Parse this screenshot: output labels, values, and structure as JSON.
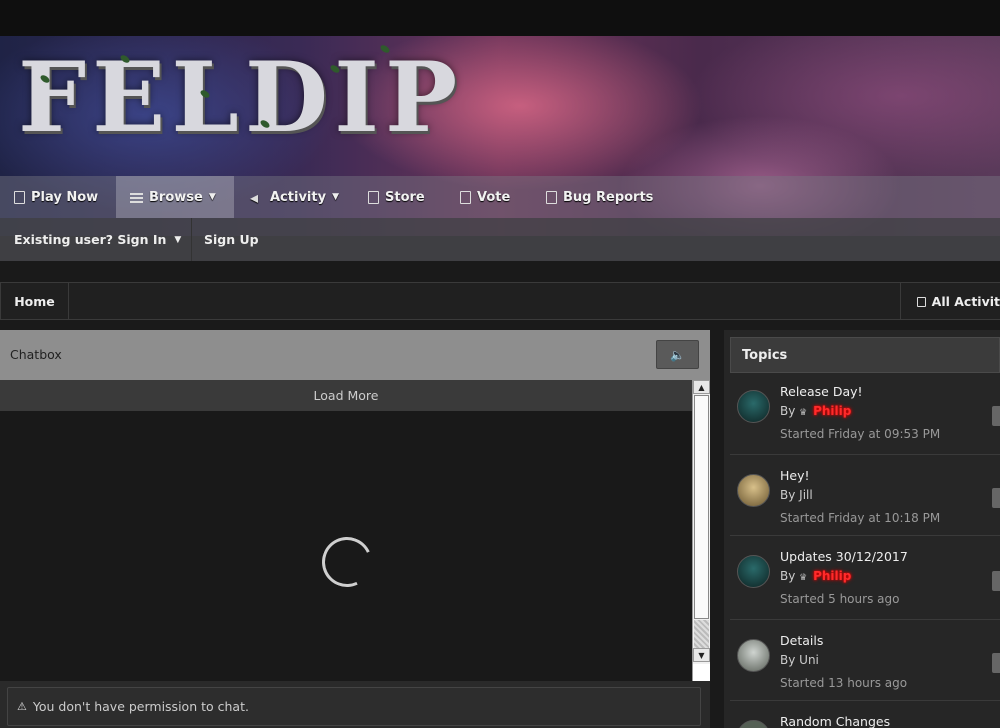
{
  "site": {
    "logo_text": "FELDIP"
  },
  "nav": {
    "items": [
      {
        "label": "Play Now",
        "icon": "file-icon"
      },
      {
        "label": "Browse",
        "icon": "list-icon",
        "active": true,
        "dropdown": true
      },
      {
        "label": "Activity",
        "icon": "megaphone-icon",
        "dropdown": true
      },
      {
        "label": "Store",
        "icon": "file-icon"
      },
      {
        "label": "Vote",
        "icon": "file-icon"
      },
      {
        "label": "Bug Reports",
        "icon": "file-icon"
      }
    ]
  },
  "userbar": {
    "signin_label": "Existing user? Sign In",
    "signup_label": "Sign Up"
  },
  "breadcrumb": {
    "home_label": "Home",
    "all_activity_label": "All Activit"
  },
  "chatbox": {
    "title": "Chatbox",
    "load_more_label": "Load More",
    "permission_message": "You don't have permission to chat."
  },
  "topics": {
    "title": "Topics",
    "items": [
      {
        "title": "Release Day!",
        "by": "By",
        "author": "Philip",
        "author_style": "highlight",
        "started": "Started Friday at 09:53 PM"
      },
      {
        "title": "Hey!",
        "by": "By",
        "author": "Jill",
        "author_style": "plain",
        "started": "Started Friday at 10:18 PM"
      },
      {
        "title": "Updates 30/12/2017",
        "by": "By",
        "author": "Philip",
        "author_style": "highlight",
        "started": "Started 5 hours ago"
      },
      {
        "title": "Details",
        "by": "By",
        "author": "Uni",
        "author_style": "plain",
        "started": "Started 13 hours ago"
      },
      {
        "title": "Random Changes",
        "by": "",
        "author": "",
        "author_style": "plain",
        "started": ""
      }
    ]
  },
  "colors": {
    "author_highlight": "#ff2b2b",
    "navbar_bg": "#78787a",
    "chat_header": "#8e8e8e"
  }
}
